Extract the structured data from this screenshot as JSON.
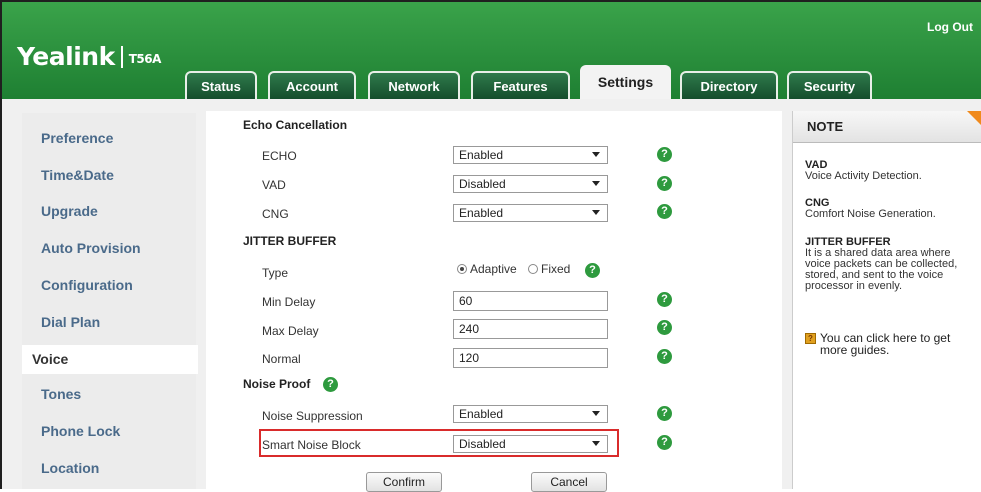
{
  "header": {
    "brand": "Yealink",
    "model": "T56A",
    "logout_label": "Log Out"
  },
  "tabs": [
    {
      "label": "Status"
    },
    {
      "label": "Account"
    },
    {
      "label": "Network"
    },
    {
      "label": "Features"
    },
    {
      "label": "Settings",
      "active": true
    },
    {
      "label": "Directory"
    },
    {
      "label": "Security"
    }
  ],
  "sidebar": {
    "items": [
      {
        "label": "Preference"
      },
      {
        "label": "Time&Date"
      },
      {
        "label": "Upgrade"
      },
      {
        "label": "Auto Provision"
      },
      {
        "label": "Configuration"
      },
      {
        "label": "Dial Plan"
      },
      {
        "label": "Voice",
        "active": true
      },
      {
        "label": "Tones"
      },
      {
        "label": "Phone Lock"
      },
      {
        "label": "Location"
      }
    ]
  },
  "main": {
    "echo_section": "Echo Cancellation",
    "echo": {
      "label": "ECHO",
      "value": "Enabled"
    },
    "vad": {
      "label": "VAD",
      "value": "Disabled"
    },
    "cng": {
      "label": "CNG",
      "value": "Enabled"
    },
    "jitter_section": "JITTER BUFFER",
    "type": {
      "label": "Type",
      "option_adaptive": "Adaptive",
      "option_fixed": "Fixed",
      "selected": "Adaptive"
    },
    "min_delay": {
      "label": "Min Delay",
      "value": "60"
    },
    "max_delay": {
      "label": "Max Delay",
      "value": "240"
    },
    "normal": {
      "label": "Normal",
      "value": "120"
    },
    "noise_section": "Noise Proof",
    "noise_suppression": {
      "label": "Noise Suppression",
      "value": "Enabled"
    },
    "smart_noise_block": {
      "label": "Smart Noise Block",
      "value": "Disabled"
    },
    "help_glyph": "?",
    "confirm_label": "Confirm",
    "cancel_label": "Cancel"
  },
  "note": {
    "title": "NOTE",
    "vad_term": "VAD",
    "vad_desc": "Voice Activity Detection.",
    "cng_term": "CNG",
    "cng_desc": "Comfort Noise Generation.",
    "jitter_term": "JITTER BUFFER",
    "jitter_desc": "It is a shared data area where voice packets can be collected, stored, and sent to the voice processor in evenly.",
    "guide_text": "You can click here to get more guides."
  },
  "colors": {
    "header_green": "#2a9a3f",
    "tab_dark": "#1e5a36",
    "sidebar_link": "#4a6a8a",
    "highlight_red": "#d92b2b",
    "help_green": "#2e9a3e",
    "note_corner": "#f08a1c"
  }
}
